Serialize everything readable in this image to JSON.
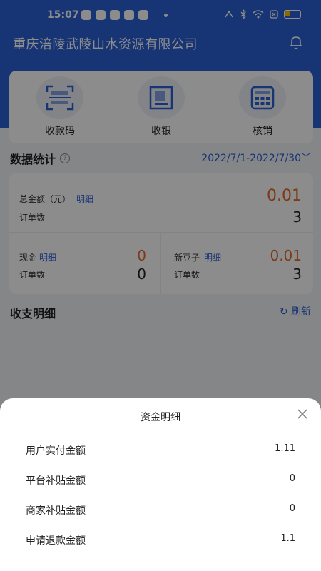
{
  "status_bar": {
    "time": "15:07"
  },
  "header": {
    "company": "重庆涪陵武陵山水资源有限公司"
  },
  "actions": [
    {
      "label": "收款码",
      "icon": "qr-scan-icon"
    },
    {
      "label": "收银",
      "icon": "receipt-icon"
    },
    {
      "label": "核销",
      "icon": "calculator-icon"
    }
  ],
  "stats": {
    "title": "数据统计",
    "date_range": "2022/7/1-2022/7/30",
    "total": {
      "label": "总金额（元）",
      "link": "明细",
      "value": "0.01",
      "orders_label": "订单数",
      "orders": "3"
    },
    "cash": {
      "label": "现金",
      "link": "明细",
      "value": "0",
      "orders_label": "订单数",
      "orders": "0"
    },
    "xindouzi": {
      "label": "新豆子",
      "link": "明细",
      "value": "0.01",
      "orders_label": "订单数",
      "orders": "3"
    }
  },
  "income": {
    "title": "收支明细",
    "refresh_label": "刷新"
  },
  "sheet": {
    "title": "资金明细",
    "rows": [
      {
        "label": "用户实付金额",
        "value": "1.11"
      },
      {
        "label": "平台补贴金额",
        "value": "0"
      },
      {
        "label": "商家补贴金额",
        "value": "0"
      },
      {
        "label": "申请退款金额",
        "value": "1.1"
      }
    ]
  },
  "colors": {
    "primary": "#2b5fd6",
    "accent_orange": "#e46a2b"
  }
}
